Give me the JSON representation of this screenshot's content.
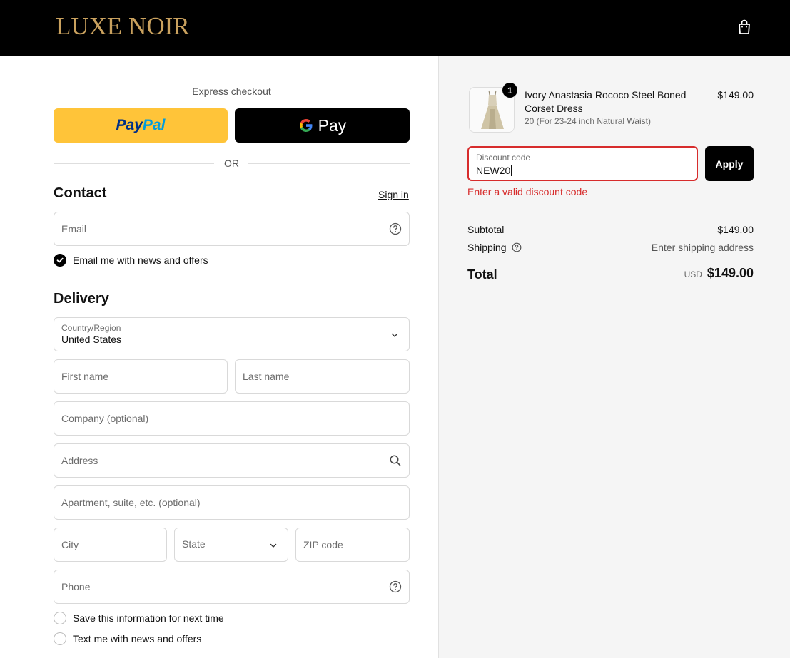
{
  "header": {
    "brand": "LUXE NOIR"
  },
  "express": {
    "title": "Express checkout",
    "paypal_part1": "Pay",
    "paypal_part2": "Pal",
    "gpay_label": "Pay",
    "or_label": "OR"
  },
  "contact": {
    "heading": "Contact",
    "sign_in": "Sign in",
    "email_placeholder": "Email",
    "news_label": "Email me with news and offers",
    "news_checked": true
  },
  "delivery": {
    "heading": "Delivery",
    "country_label": "Country/Region",
    "country_value": "United States",
    "first_name": "First name",
    "last_name": "Last name",
    "company": "Company (optional)",
    "address": "Address",
    "apartment": "Apartment, suite, etc. (optional)",
    "city": "City",
    "state": "State",
    "zip": "ZIP code",
    "phone": "Phone",
    "save_info": "Save this information for next time",
    "text_me": "Text me with news and offers"
  },
  "order": {
    "quantity": "1",
    "product_name": "Ivory Anastasia Rococo Steel Boned Corset Dress",
    "variant": "20 (For 23-24 inch Natural Waist)",
    "price": "$149.00",
    "discount_label": "Discount code",
    "discount_value": "NEW20",
    "apply_label": "Apply",
    "error": "Enter a valid discount code",
    "subtotal_label": "Subtotal",
    "subtotal_value": "$149.00",
    "shipping_label": "Shipping",
    "shipping_value": "Enter shipping address",
    "total_label": "Total",
    "currency": "USD",
    "total_value": "$149.00"
  },
  "colors": {
    "brand_gold": "#c9a15e",
    "paypal_yellow": "#ffc439",
    "error_red": "#d72c2c"
  }
}
